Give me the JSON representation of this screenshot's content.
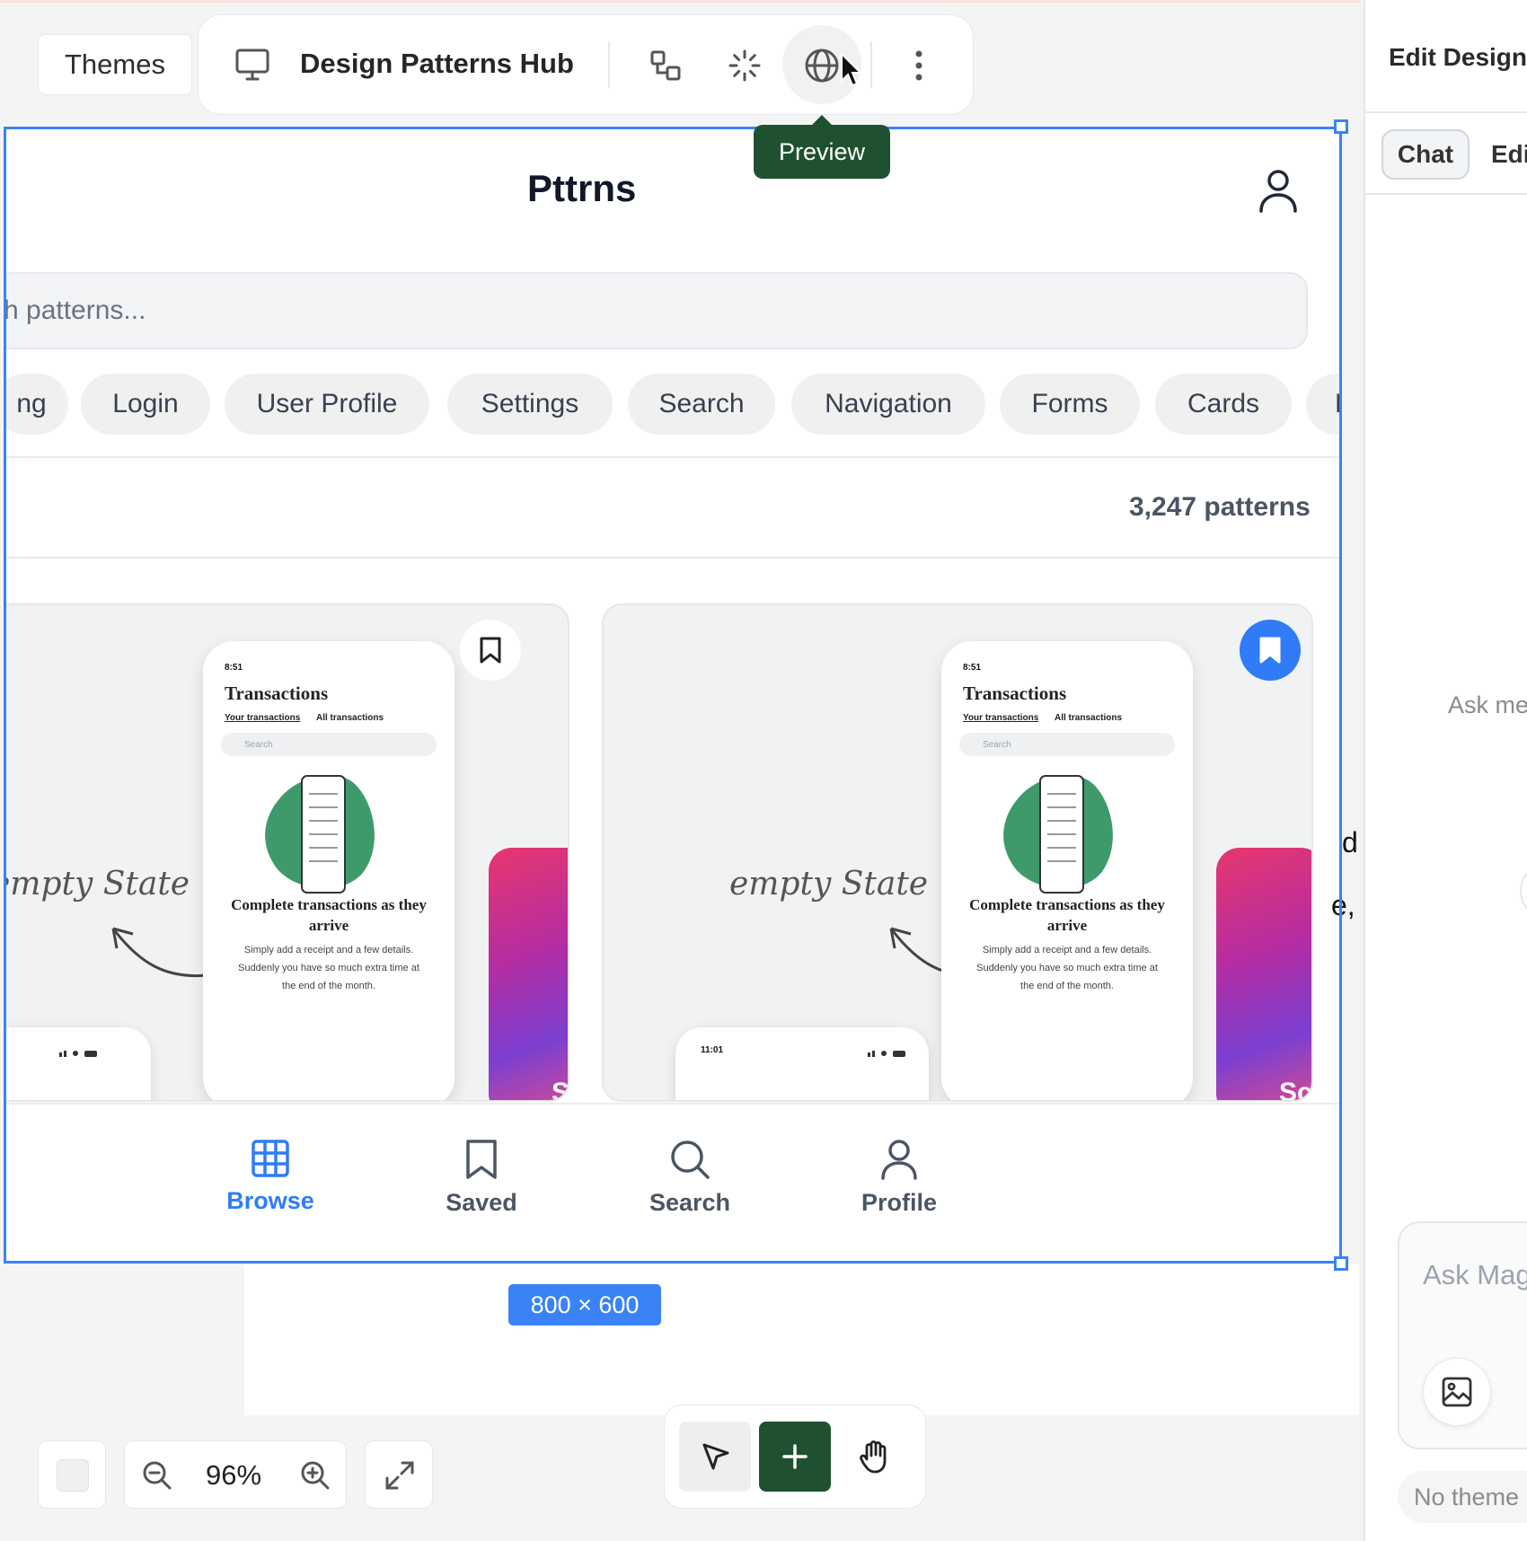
{
  "toolbar": {
    "themes_label": "Themes",
    "title": "Design Patterns Hub",
    "tooltip": "Preview"
  },
  "app": {
    "title": "Pttrns",
    "search_placeholder": "h patterns...",
    "chips": [
      "ng",
      "Login",
      "User Profile",
      "Settings",
      "Search",
      "Navigation",
      "Forms",
      "Cards",
      "L"
    ],
    "count": "3,247 patterns",
    "cards": [
      {
        "phone_time": "8:51",
        "phone_title": "Transactions",
        "tab_1": "Your transactions",
        "tab_2": "All transactions",
        "search": "Search",
        "headline": "Complete transactions as they arrive",
        "body": "Simply add a receipt and a few details. Suddenly you have so much extra time at the end of the month.",
        "handwriting": "empty State",
        "second_phone_time": "",
        "side_card_text": "Sc",
        "saved": false
      },
      {
        "phone_time": "8:51",
        "phone_title": "Transactions",
        "tab_1": "Your transactions",
        "tab_2": "All transactions",
        "search": "Search",
        "headline": "Complete transactions as they arrive",
        "body": "Simply add a receipt and a few details. Suddenly you have so much extra time at the end of the month.",
        "handwriting": "empty State",
        "second_phone_time": "11:01",
        "side_card_text": "Sc",
        "saved": true
      }
    ],
    "bottom_nav": [
      {
        "label": "Browse",
        "icon": "grid-icon",
        "active": true
      },
      {
        "label": "Saved",
        "icon": "bookmark-icon",
        "active": false
      },
      {
        "label": "Search",
        "icon": "search-icon",
        "active": false
      },
      {
        "label": "Profile",
        "icon": "user-icon",
        "active": false
      }
    ]
  },
  "frame": {
    "size_label": "800 × 600",
    "overflow_text_1": "d",
    "overflow_text_2": "e,"
  },
  "canvas_controls": {
    "zoom": "96%"
  },
  "right_panel": {
    "title": "Edit Design",
    "tab_chat": "Chat",
    "tab_edit": "Edi",
    "ask_placeholder": "Ask me",
    "input_placeholder": "Ask Mag",
    "no_theme": "No theme"
  },
  "colors": {
    "accent_blue": "#3b82f6",
    "brand_green": "#1f5130",
    "selection_blue": "#3b82f6"
  }
}
